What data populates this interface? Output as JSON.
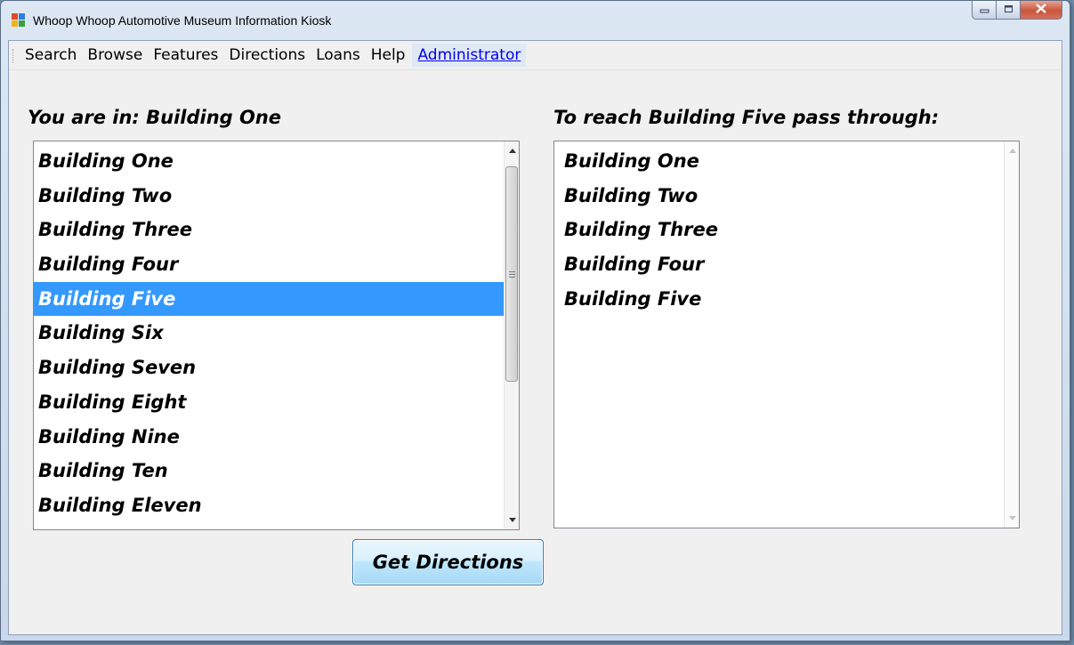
{
  "window": {
    "title": "Whoop Whoop Automotive Museum Information Kiosk",
    "icon": "windows-forms-app-icon",
    "caption_buttons": {
      "minimize_icon": "minimize-icon",
      "maximize_icon": "maximize-icon",
      "close_icon": "close-icon"
    }
  },
  "menu": {
    "items": [
      "Search",
      "Browse",
      "Features",
      "Directions",
      "Loans",
      "Help"
    ],
    "admin_link": "Administrator",
    "link_color": "#0000ee"
  },
  "left": {
    "heading": "You are in:  Building One",
    "selected_index": 4,
    "selection_color": "#3399ff",
    "items": [
      "Building One",
      "Building Two",
      "Building Three",
      "Building Four",
      "Building Five",
      "Building Six",
      "Building Seven",
      "Building Eight",
      "Building Nine",
      "Building Ten",
      "Building Eleven"
    ]
  },
  "right": {
    "heading": "To reach Building Five pass through:",
    "items": [
      "Building One",
      "Building Two",
      "Building Three",
      "Building Four",
      "Building Five"
    ]
  },
  "actions": {
    "get_directions_label": "Get Directions"
  }
}
